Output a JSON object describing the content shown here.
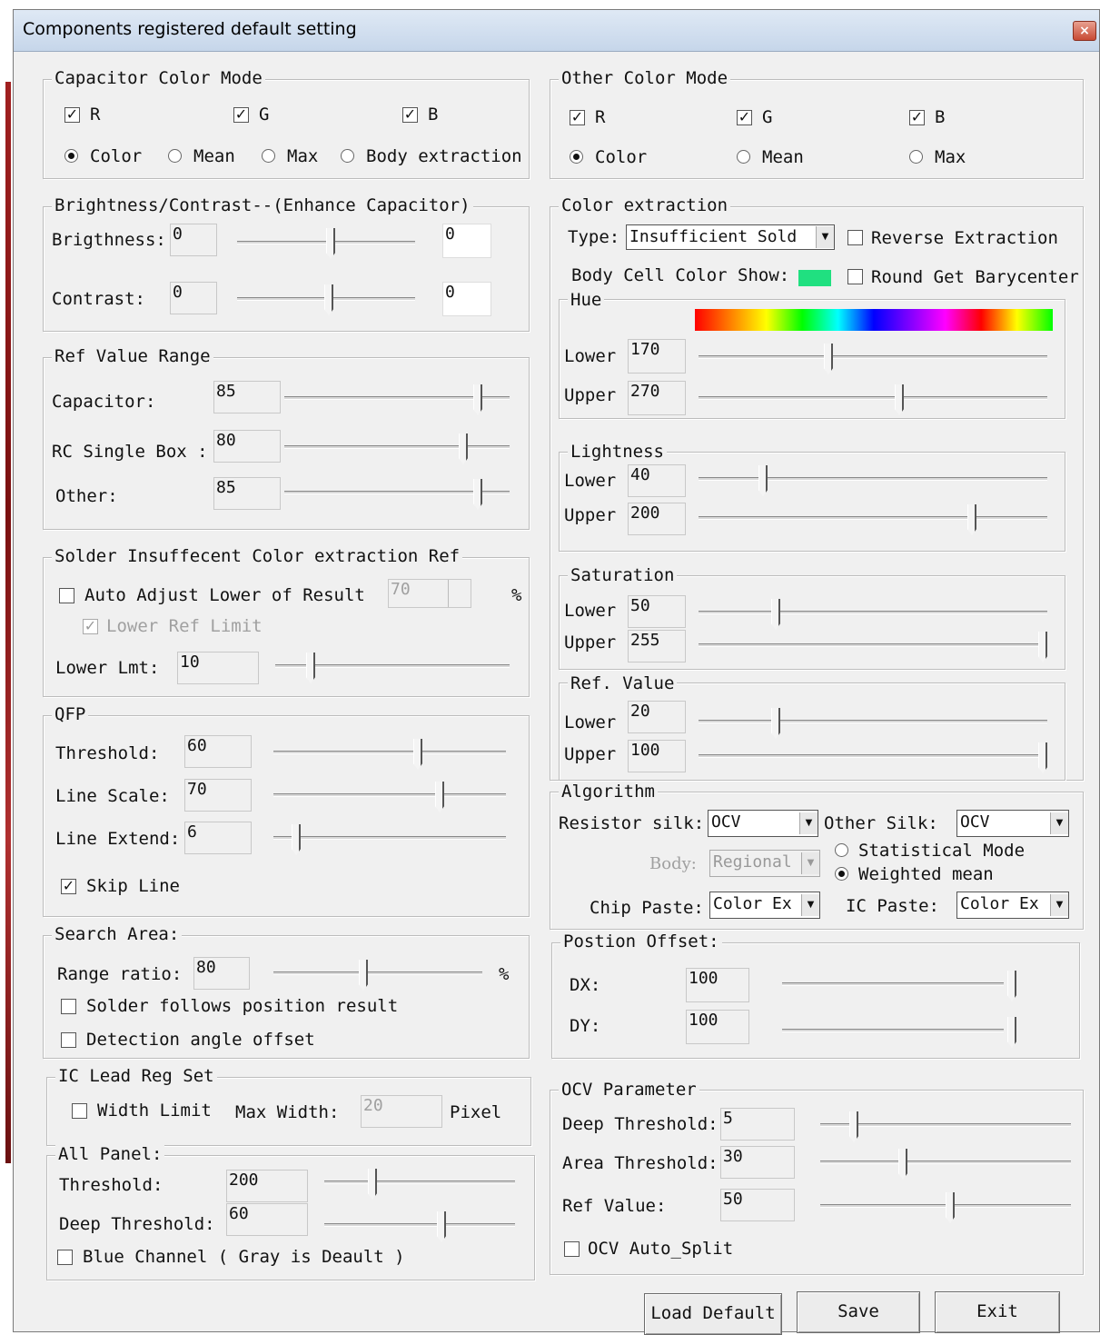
{
  "window": {
    "title": "Components registered default setting",
    "close": "×"
  },
  "capacitor_color_mode": {
    "legend": "Capacitor Color Mode",
    "r": "R",
    "g": "G",
    "b": "B",
    "color": "Color",
    "mean": "Mean",
    "max": "Max",
    "body_extraction": "Body extraction"
  },
  "brightness_contrast": {
    "legend": "Brightness/Contrast--(Enhance Capacitor)",
    "brightness_label": "Brigthness:",
    "brightness_value": "0",
    "brightness_value2": "0",
    "contrast_label": "Contrast:",
    "contrast_value": "0",
    "contrast_value2": "0"
  },
  "ref_value_range": {
    "legend": "Ref Value Range",
    "capacitor_label": "Capacitor:",
    "capacitor_value": "85",
    "rc_label": "RC Single Box :",
    "rc_value": "80",
    "other_label": "Other:",
    "other_value": "85"
  },
  "solder": {
    "legend": "Solder Insuffecent Color extraction Ref",
    "auto_adjust": "Auto Adjust Lower of Result",
    "auto_value": "70",
    "percent": "%",
    "lower_ref_limit": "Lower  Ref Limit",
    "lower_lmt_label": "Lower Lmt:",
    "lower_lmt_value": "10"
  },
  "qfp": {
    "legend": "QFP",
    "threshold_label": "Threshold:",
    "threshold_value": "60",
    "line_scale_label": "Line Scale:",
    "line_scale_value": "70",
    "line_extend_label": "Line Extend:",
    "line_extend_value": "6",
    "skip_line": "Skip Line"
  },
  "search_area": {
    "legend": "Search Area:",
    "range_label": "Range ratio:",
    "range_value": "80",
    "percent": "%",
    "solder_follows": "Solder follows position result",
    "detection_angle": "Detection angle offset"
  },
  "ic_lead": {
    "legend": "IC Lead Reg Set",
    "width_limit": "Width Limit",
    "max_width_label": "Max Width:",
    "max_width_value": "20",
    "pixel": "Pixel"
  },
  "all_panel": {
    "legend": "All Panel:",
    "threshold_label": "Threshold:",
    "threshold_value": "200",
    "deep_label": "Deep Threshold:",
    "deep_value": "60",
    "blue_channel": "Blue Channel ( Gray is Deault )"
  },
  "other_color_mode": {
    "legend": "Other Color Mode",
    "r": "R",
    "g": "G",
    "b": "B",
    "color": "Color",
    "mean": "Mean",
    "max": "Max"
  },
  "color_extraction": {
    "legend": "Color extraction",
    "type_label": "Type:",
    "type_value": "Insufficient Sold",
    "reverse": "Reverse Extraction",
    "body_cell": "Body Cell Color Show:",
    "round_get": "Round Get Barycenter",
    "swatch_color": "#20e080",
    "hue": {
      "legend": "Hue",
      "lower_label": "Lower",
      "lower_value": "170",
      "upper_label": "Upper",
      "upper_value": "270"
    },
    "lightness": {
      "legend": "Lightness",
      "lower_label": "Lower",
      "lower_value": "40",
      "upper_label": "Upper",
      "upper_value": "200"
    },
    "saturation": {
      "legend": "Saturation",
      "lower_label": "Lower",
      "lower_value": "50",
      "upper_label": "Upper",
      "upper_value": "255"
    },
    "ref_value": {
      "legend": "Ref. Value",
      "lower_label": "Lower",
      "lower_value": "20",
      "upper_label": "Upper",
      "upper_value": "100"
    }
  },
  "algorithm": {
    "legend": "Algorithm",
    "resistor_label": "Resistor silk:",
    "resistor_value": "OCV",
    "other_silk_label": "Other Silk:",
    "other_silk_value": "OCV",
    "body_label": "Body:",
    "body_value": "Regional",
    "statistical": "Statistical Mode",
    "weighted": "Weighted mean",
    "chip_paste_label": "Chip Paste:",
    "chip_paste_value": "Color Ex",
    "ic_paste_label": "IC Paste:",
    "ic_paste_value": "Color Ex"
  },
  "position_offset": {
    "legend": "Postion Offset:",
    "dx_label": "DX:",
    "dx_value": "100",
    "dy_label": "DY:",
    "dy_value": "100"
  },
  "ocv": {
    "legend": "OCV Parameter",
    "deep_label": "Deep Threshold:",
    "deep_value": "5",
    "area_label": "Area Threshold:",
    "area_value": "30",
    "ref_label": "Ref Value:",
    "ref_value": "50",
    "auto_split": "OCV Auto_Split"
  },
  "buttons": {
    "load_default": "Load Default",
    "save": "Save",
    "exit": "Exit"
  }
}
